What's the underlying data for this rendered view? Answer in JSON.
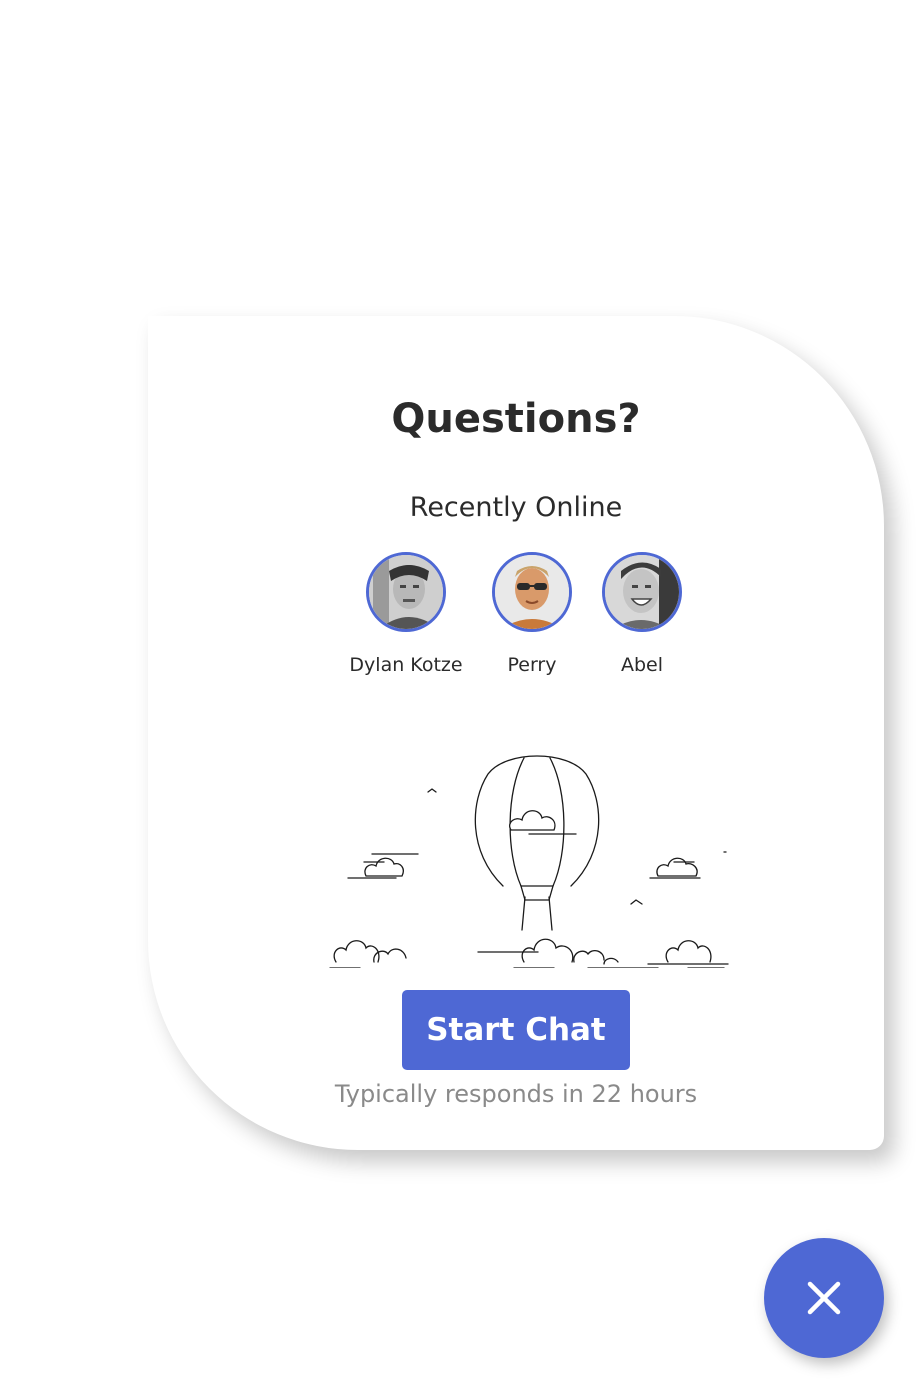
{
  "widget": {
    "title": "Questions?",
    "subtitle": "Recently Online",
    "agents": [
      {
        "name": "Dylan Kotze",
        "avatar_icon": "person-photo"
      },
      {
        "name": "Perry",
        "avatar_icon": "person-photo"
      },
      {
        "name": "Abel",
        "avatar_icon": "person-photo"
      }
    ],
    "illustration_icon": "hot-air-balloon-with-clouds",
    "start_button_label": "Start Chat",
    "response_text": "Typically responds in 22 hours"
  },
  "close_button": {
    "icon": "close-icon"
  },
  "colors": {
    "accent": "#4e68d4",
    "title_text": "#2b2b2b",
    "muted_text": "#8a8a8a",
    "background": "#ffffff"
  }
}
